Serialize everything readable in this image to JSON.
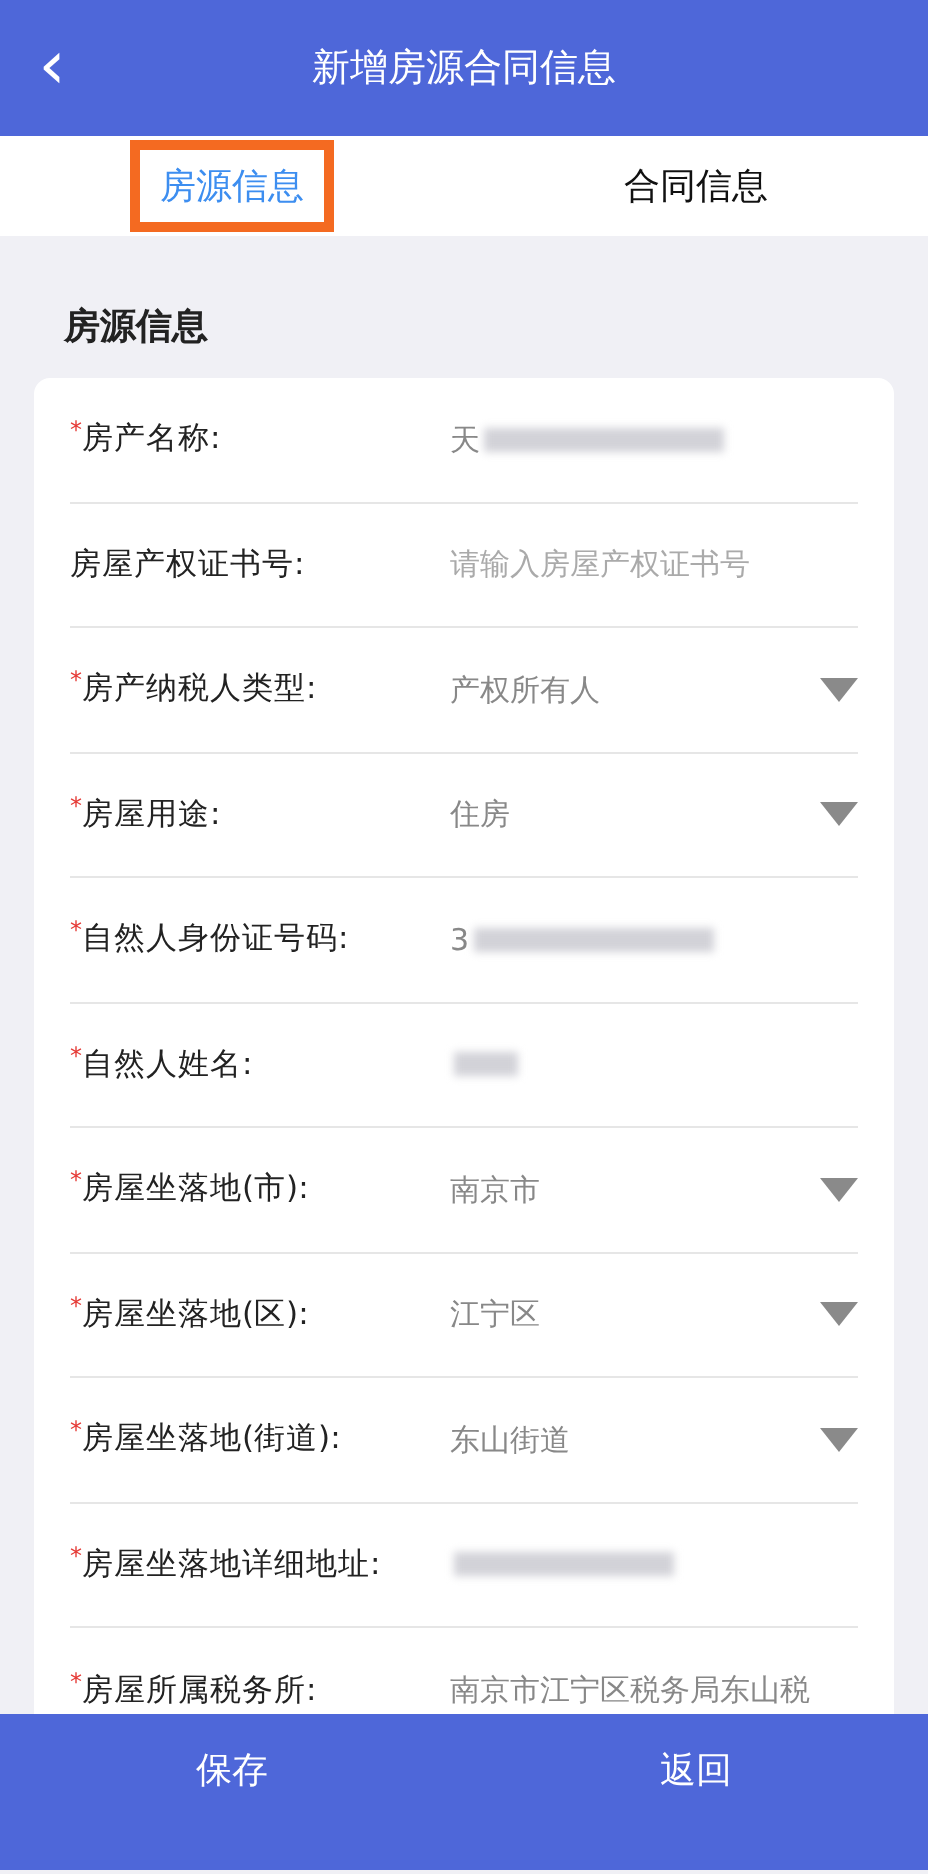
{
  "header": {
    "back_icon": "‹",
    "title": "新增房源合同信息"
  },
  "tabs": [
    {
      "label": "房源信息",
      "selected": true,
      "highlighted": true
    },
    {
      "label": "合同信息",
      "selected": false,
      "highlighted": false
    }
  ],
  "section_title": "房源信息",
  "fields": [
    {
      "kind": "text",
      "required_mark": "*",
      "label": "房产名称:",
      "value": "天",
      "redacted": true
    },
    {
      "kind": "text",
      "label": "房屋产权证书号:",
      "placeholder": "请输入房屋产权证书号"
    },
    {
      "kind": "select",
      "required_mark": "*",
      "label": "房产纳税人类型:",
      "value": "产权所有人"
    },
    {
      "kind": "select",
      "required_mark": "*",
      "label": "房屋用途:",
      "value": "住房"
    },
    {
      "kind": "text",
      "required_mark": "*",
      "label": "自然人身份证号码:",
      "value": "3",
      "redacted": true
    },
    {
      "kind": "text",
      "required_mark": "*",
      "label": "自然人姓名:",
      "redacted": true
    },
    {
      "kind": "select",
      "required_mark": "*",
      "label": "房屋坐落地(市):",
      "value": "南京市"
    },
    {
      "kind": "select",
      "required_mark": "*",
      "label": "房屋坐落地(区):",
      "value": "江宁区"
    },
    {
      "kind": "select",
      "required_mark": "*",
      "label": "房屋坐落地(街道):",
      "value": "东山街道"
    },
    {
      "kind": "text",
      "required_mark": "*",
      "label": "房屋坐落地详细地址:",
      "redacted": true
    },
    {
      "kind": "text",
      "required_mark": "*",
      "label": "房屋所属税务所:",
      "value": "南京市江宁区税务局东山税"
    }
  ],
  "footer_buttons": [
    "保存",
    "返回"
  ]
}
